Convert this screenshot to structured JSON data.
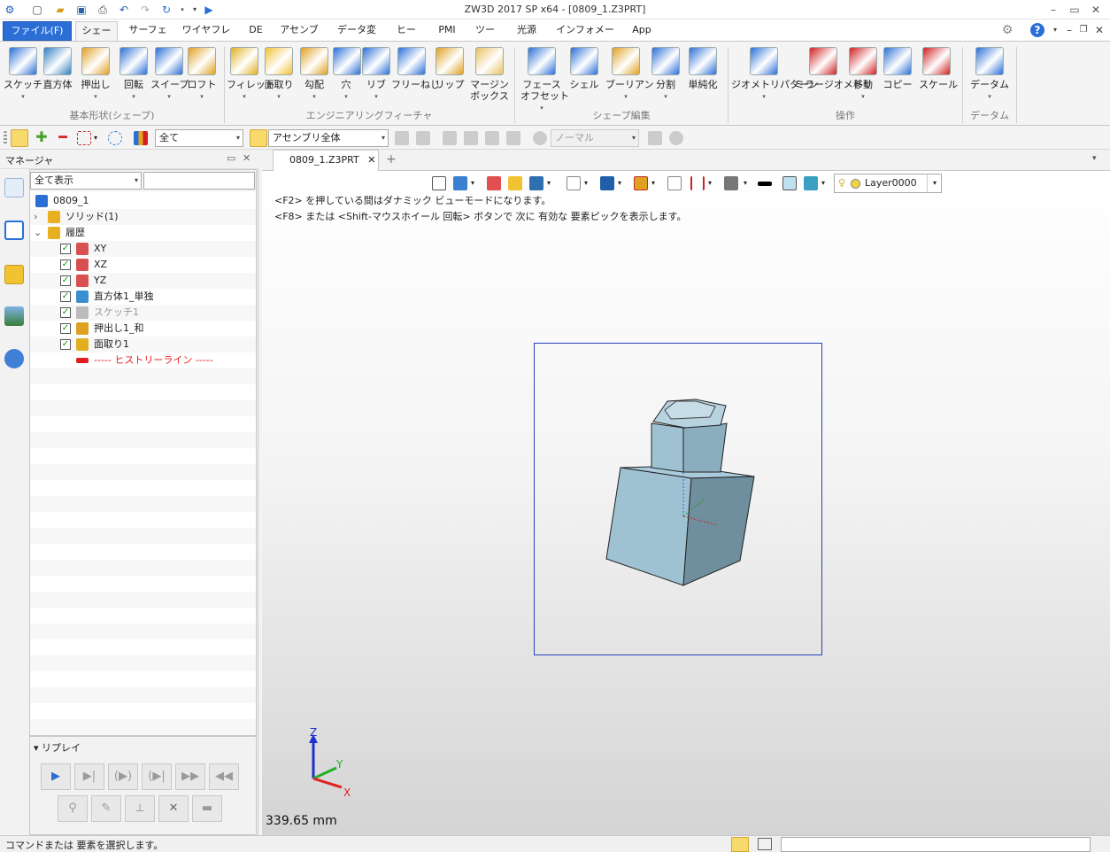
{
  "window": {
    "title": "ZW3D 2017 SP x64 - [0809_1.Z3PRT]"
  },
  "menu_tabs": [
    {
      "label": "ファイル(F)",
      "active": false,
      "file": true
    },
    {
      "label": "シェープ",
      "active": true
    },
    {
      "label": "サーフェス"
    },
    {
      "label": "ワイヤフレーム"
    },
    {
      "label": "DE"
    },
    {
      "label": "アセンブリ"
    },
    {
      "label": "データ変換"
    },
    {
      "label": "ヒール"
    },
    {
      "label": "PMI"
    },
    {
      "label": "ツール"
    },
    {
      "label": "光源"
    },
    {
      "label": "インフォメーション"
    },
    {
      "label": "App"
    }
  ],
  "ribbon": {
    "groups": [
      {
        "label": "基本形状(シェープ)"
      },
      {
        "label": "エンジニアリングフィーチャ"
      },
      {
        "label": "シェープ編集"
      },
      {
        "label": "操作"
      },
      {
        "label": "データム"
      }
    ],
    "buttons": [
      {
        "label": "スケッチ",
        "icon": "sketch-icon"
      },
      {
        "label": "直方体",
        "icon": "box-icon"
      },
      {
        "label": "押出し",
        "icon": "extrude-icon"
      },
      {
        "label": "回転",
        "icon": "revolve-icon"
      },
      {
        "label": "スイープ",
        "icon": "sweep-icon"
      },
      {
        "label": "ロフト",
        "icon": "loft-icon"
      },
      {
        "label": "フィレット",
        "icon": "fillet-icon"
      },
      {
        "label": "面取り",
        "icon": "chamfer-icon"
      },
      {
        "label": "勾配",
        "icon": "draft-icon"
      },
      {
        "label": "穴",
        "icon": "hole-icon"
      },
      {
        "label": "リブ",
        "icon": "rib-icon"
      },
      {
        "label": "フリーねじ",
        "icon": "thread-icon"
      },
      {
        "label": "リップ",
        "icon": "lip-icon"
      },
      {
        "label": "マージン\nボックス",
        "icon": "margin-box-icon"
      },
      {
        "label": "フェース\nオフセット",
        "icon": "face-offset-icon"
      },
      {
        "label": "シェル",
        "icon": "shell-icon"
      },
      {
        "label": "ブーリアン",
        "icon": "boolean-icon"
      },
      {
        "label": "分割",
        "icon": "split-icon"
      },
      {
        "label": "単純化",
        "icon": "simplify-icon"
      },
      {
        "label": "ジオメトリパターン",
        "icon": "pattern-icon"
      },
      {
        "label": "ミラージオメトリ",
        "icon": "mirror-icon"
      },
      {
        "label": "移動",
        "icon": "move-icon"
      },
      {
        "label": "コピー",
        "icon": "copy-icon"
      },
      {
        "label": "スケール",
        "icon": "scale-icon"
      },
      {
        "label": "データム",
        "icon": "datum-icon"
      }
    ]
  },
  "toolbar2": {
    "filter_value": "全て",
    "scope_value": "アセンブリ全体",
    "mode_value": "ノーマル"
  },
  "manager": {
    "title": "マネージャ",
    "filter_value": "全て表示",
    "tree": [
      {
        "label": "0809_1",
        "level": 0,
        "icon": "part-icon"
      },
      {
        "label": "ソリッド(1)",
        "level": 1,
        "icon": "folder-icon",
        "expander": "›"
      },
      {
        "label": "履歴",
        "level": 1,
        "icon": "folder-icon",
        "expander": "⌄"
      },
      {
        "label": "XY",
        "level": 2,
        "icon": "plane-icon",
        "checked": true
      },
      {
        "label": "XZ",
        "level": 2,
        "icon": "plane-icon",
        "checked": true
      },
      {
        "label": "YZ",
        "level": 2,
        "icon": "plane-icon",
        "checked": true
      },
      {
        "label": "直方体1_単独",
        "level": 2,
        "icon": "box-feature-icon",
        "checked": true
      },
      {
        "label": "スケッチ1",
        "level": 2,
        "icon": "sketch-feature-icon",
        "checked": true,
        "dim": true
      },
      {
        "label": "押出し1_和",
        "level": 2,
        "icon": "extrude-feature-icon",
        "checked": true
      },
      {
        "label": "面取り1",
        "level": 2,
        "icon": "chamfer-feature-icon",
        "checked": true
      },
      {
        "label": "----- ヒストリーライン -----",
        "level": 2,
        "icon": "history-line-icon",
        "history": true
      }
    ]
  },
  "replay": {
    "title": "リプレイ"
  },
  "document": {
    "tab_label": "0809_1.Z3PRT",
    "layer": "Layer0000",
    "hint1": "<F2> を押している間はダナミック ビューモードになります。",
    "hint2": "<F8> または <Shift-マウスホイール 回転> ボタンで 次に 有効な 要素ピックを表示します。",
    "scale_readout": "339.65 mm",
    "axis_labels": {
      "x": "X",
      "y": "Y",
      "z": "Z"
    }
  },
  "status": {
    "message": "コマンドまたは 要素を選択します。"
  },
  "colors": {
    "accent": "#2b6fd6",
    "part": "#9fc2d2",
    "history_red": "#e02020"
  }
}
